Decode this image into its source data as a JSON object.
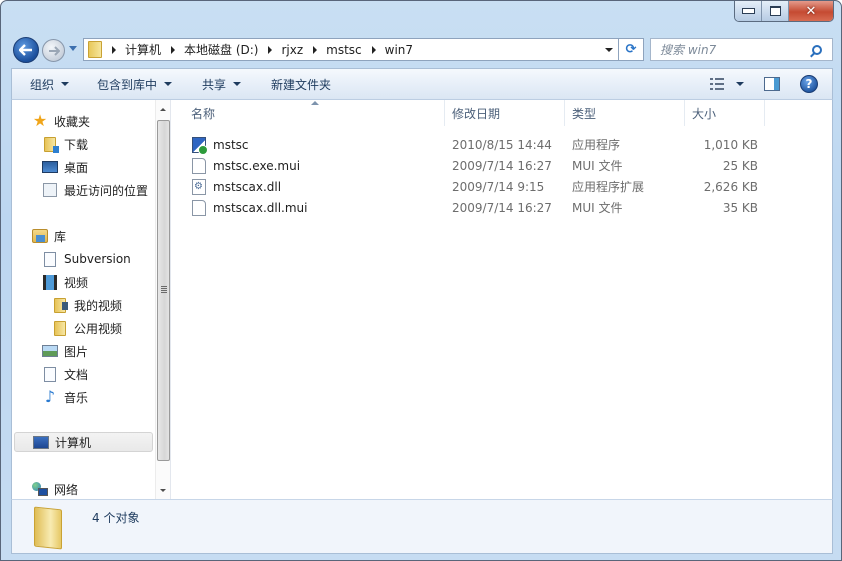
{
  "window": {
    "controls": {
      "minimize": "minimize",
      "maximize": "maximize",
      "close": "✕"
    }
  },
  "nav": {
    "back_icon": "←",
    "forward_icon": "→",
    "breadcrumb": [
      "计算机",
      "本地磁盘 (D:)",
      "rjxz",
      "mstsc",
      "win7"
    ],
    "refresh_icon": "⟳",
    "search_placeholder": "搜索 win7"
  },
  "toolbar": {
    "organize": "组织",
    "include_in_library": "包含到库中",
    "share": "共享",
    "new_folder": "新建文件夹",
    "help_icon": "?"
  },
  "sidebar": {
    "favorites": {
      "label": "收藏夹",
      "items": [
        "下载",
        "桌面",
        "最近访问的位置"
      ]
    },
    "libraries": {
      "label": "库",
      "items": [
        "Subversion",
        "视频",
        "我的视频",
        "公用视频",
        "图片",
        "文档",
        "音乐"
      ]
    },
    "computer": "计算机",
    "network": "网络"
  },
  "columns": [
    "名称",
    "修改日期",
    "类型",
    "大小"
  ],
  "files": [
    {
      "name": "mstsc",
      "icon": "exe-icon",
      "modified": "2010/8/15 14:44",
      "type": "应用程序",
      "size": "1,010 KB"
    },
    {
      "name": "mstsc.exe.mui",
      "icon": "file-icon",
      "modified": "2009/7/14 16:27",
      "type": "MUI 文件",
      "size": "25 KB"
    },
    {
      "name": "mstscax.dll",
      "icon": "dll-icon",
      "modified": "2009/7/14 9:15",
      "type": "应用程序扩展",
      "size": "2,626 KB"
    },
    {
      "name": "mstscax.dll.mui",
      "icon": "file-icon",
      "modified": "2009/7/14 16:27",
      "type": "MUI 文件",
      "size": "35 KB"
    }
  ],
  "status": {
    "count": "4 个对象"
  }
}
